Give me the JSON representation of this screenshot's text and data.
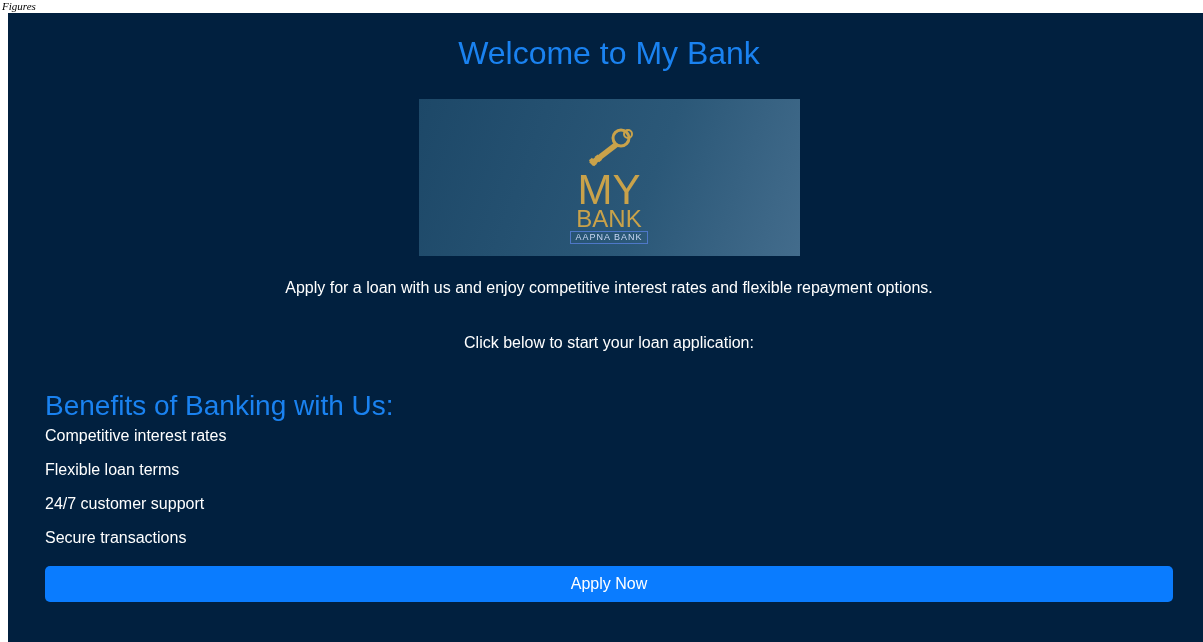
{
  "caption": "Figures",
  "title": "Welcome to My Bank",
  "logo": {
    "line_1": "MY",
    "line_2": "BANK",
    "tagline": "AAPNA BANK"
  },
  "intro": "Apply for a loan with us and enjoy competitive interest rates and flexible repayment options.",
  "prompt": "Click below to start your loan application:",
  "benefits": {
    "heading": "Benefits of Banking with Us:",
    "items": [
      "Competitive interest rates",
      "Flexible loan terms",
      "24/7 customer support",
      "Secure transactions"
    ]
  },
  "button": "Apply Now"
}
